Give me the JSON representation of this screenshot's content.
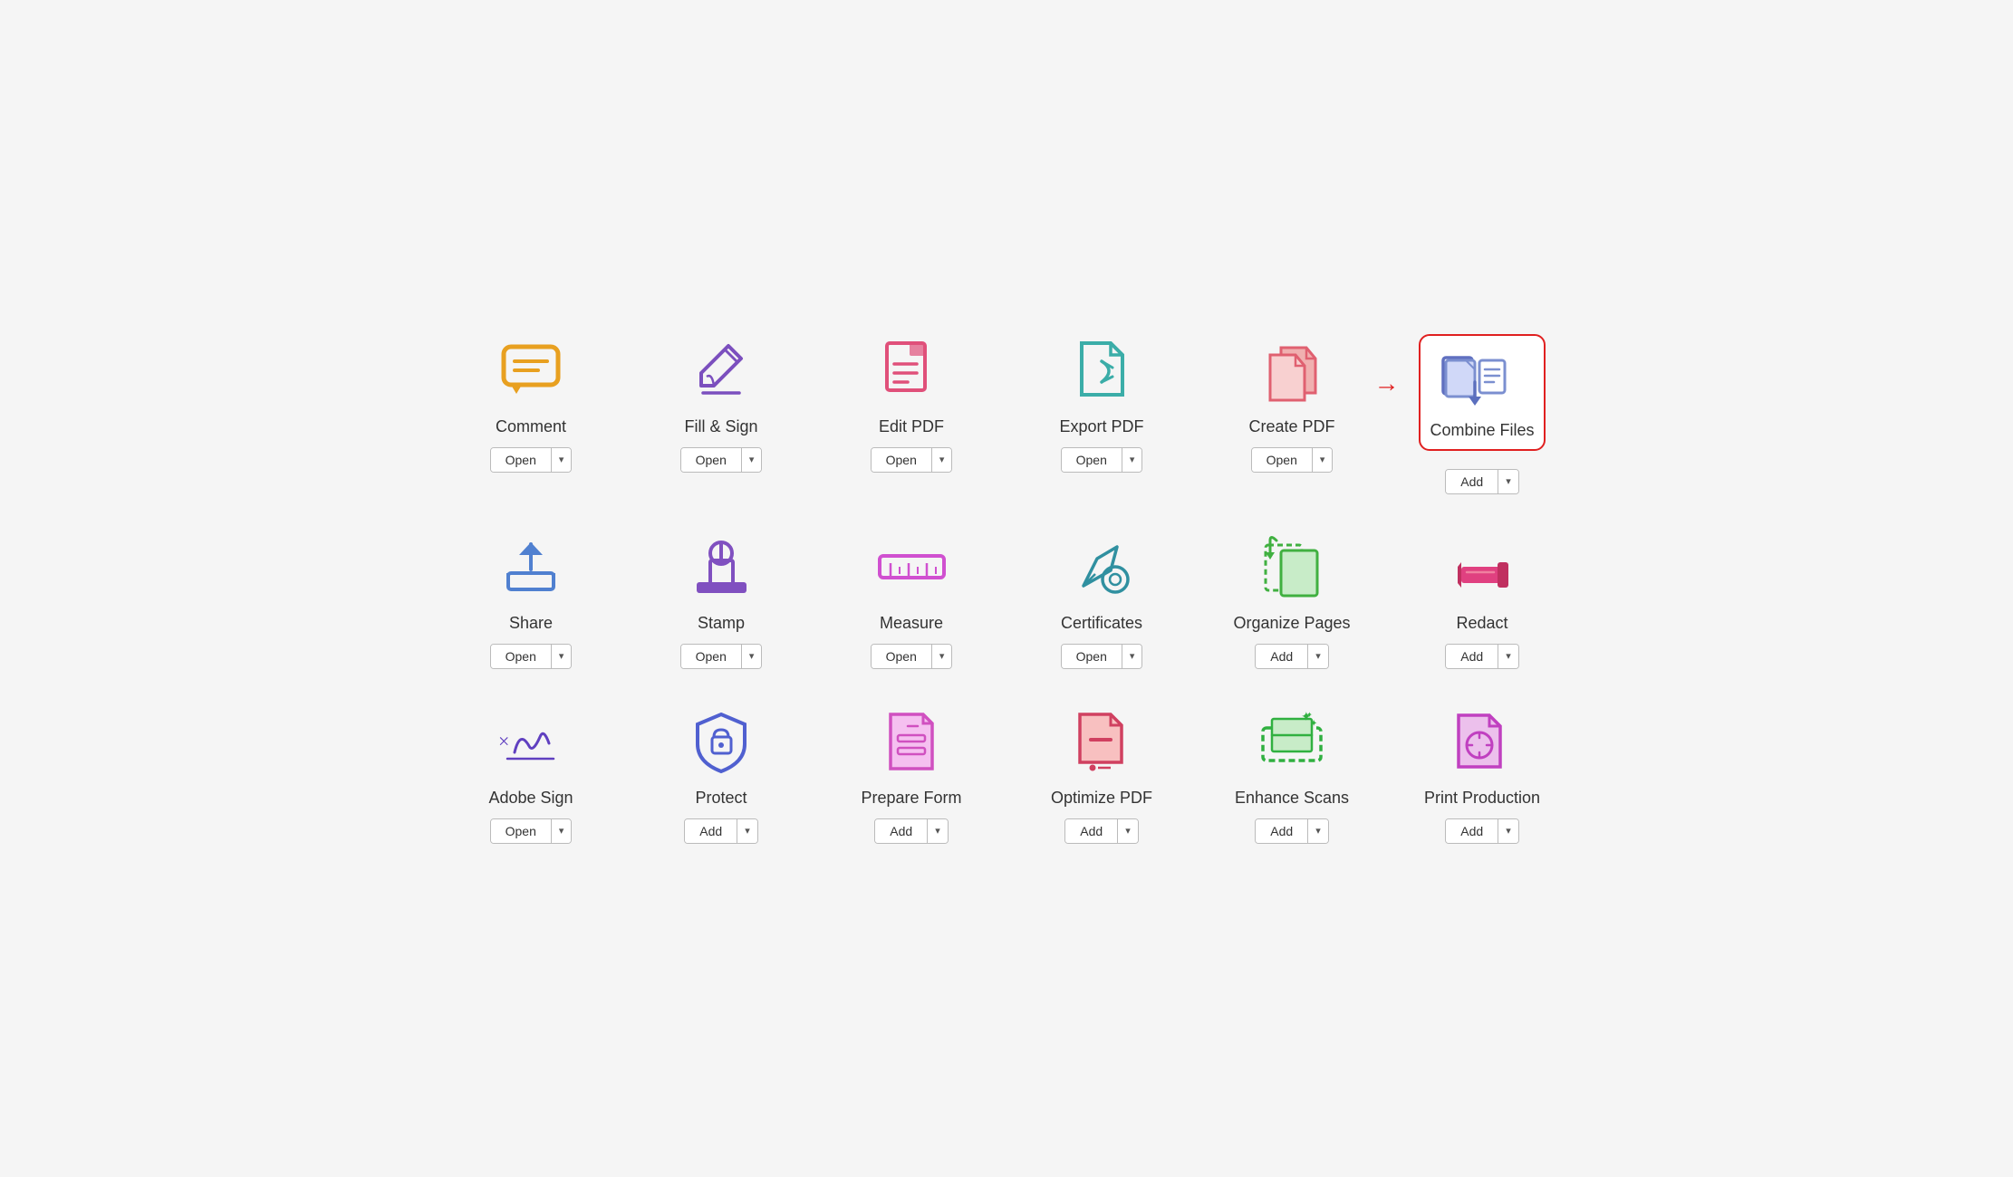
{
  "tools": [
    {
      "id": "comment",
      "name": "Comment",
      "button": "Open",
      "row": 1,
      "icon_color": "#E8A020",
      "icon_type": "comment"
    },
    {
      "id": "fill-sign",
      "name": "Fill & Sign",
      "button": "Open",
      "row": 1,
      "icon_color": "#7B4FBE",
      "icon_type": "fill-sign"
    },
    {
      "id": "edit-pdf",
      "name": "Edit PDF",
      "button": "Open",
      "row": 1,
      "icon_color": "#E0507A",
      "icon_type": "edit-pdf"
    },
    {
      "id": "export-pdf",
      "name": "Export PDF",
      "button": "Open",
      "row": 1,
      "icon_color": "#3BADA8",
      "icon_type": "export-pdf"
    },
    {
      "id": "create-pdf",
      "name": "Create PDF",
      "button": "Open",
      "row": 1,
      "icon_color": "#E06070",
      "icon_type": "create-pdf"
    },
    {
      "id": "combine-files",
      "name": "Combine Files",
      "button": "Add",
      "row": 1,
      "icon_color": "#5B6FBE",
      "icon_type": "combine-files",
      "highlight": true
    },
    {
      "id": "share",
      "name": "Share",
      "button": "Open",
      "row": 2,
      "icon_color": "#5080D0",
      "icon_type": "share"
    },
    {
      "id": "stamp",
      "name": "Stamp",
      "button": "Open",
      "row": 2,
      "icon_color": "#8050C0",
      "icon_type": "stamp"
    },
    {
      "id": "measure",
      "name": "Measure",
      "button": "Open",
      "row": 2,
      "icon_color": "#D050D0",
      "icon_type": "measure"
    },
    {
      "id": "certificates",
      "name": "Certificates",
      "button": "Open",
      "row": 2,
      "icon_color": "#3090A0",
      "icon_type": "certificates"
    },
    {
      "id": "organize-pages",
      "name": "Organize Pages",
      "button": "Add",
      "row": 2,
      "icon_color": "#40B040",
      "icon_type": "organize-pages"
    },
    {
      "id": "redact",
      "name": "Redact",
      "button": "Add",
      "row": 2,
      "icon_color": "#E04080",
      "icon_type": "redact"
    },
    {
      "id": "adobe-sign",
      "name": "Adobe Sign",
      "button": "Open",
      "row": 3,
      "icon_color": "#6040C0",
      "icon_type": "adobe-sign"
    },
    {
      "id": "protect",
      "name": "Protect",
      "button": "Add",
      "row": 3,
      "icon_color": "#5060D0",
      "icon_type": "protect"
    },
    {
      "id": "prepare-form",
      "name": "Prepare Form",
      "button": "Add",
      "row": 3,
      "icon_color": "#D050C0",
      "icon_type": "prepare-form"
    },
    {
      "id": "optimize-pdf",
      "name": "Optimize PDF",
      "button": "Add",
      "row": 3,
      "icon_color": "#D04060",
      "icon_type": "optimize-pdf"
    },
    {
      "id": "enhance-scans",
      "name": "Enhance Scans",
      "button": "Add",
      "row": 3,
      "icon_color": "#30B040",
      "icon_type": "enhance-scans"
    },
    {
      "id": "print-production",
      "name": "Print Production",
      "button": "Add",
      "row": 3,
      "icon_color": "#C040C0",
      "icon_type": "print-production"
    }
  ]
}
